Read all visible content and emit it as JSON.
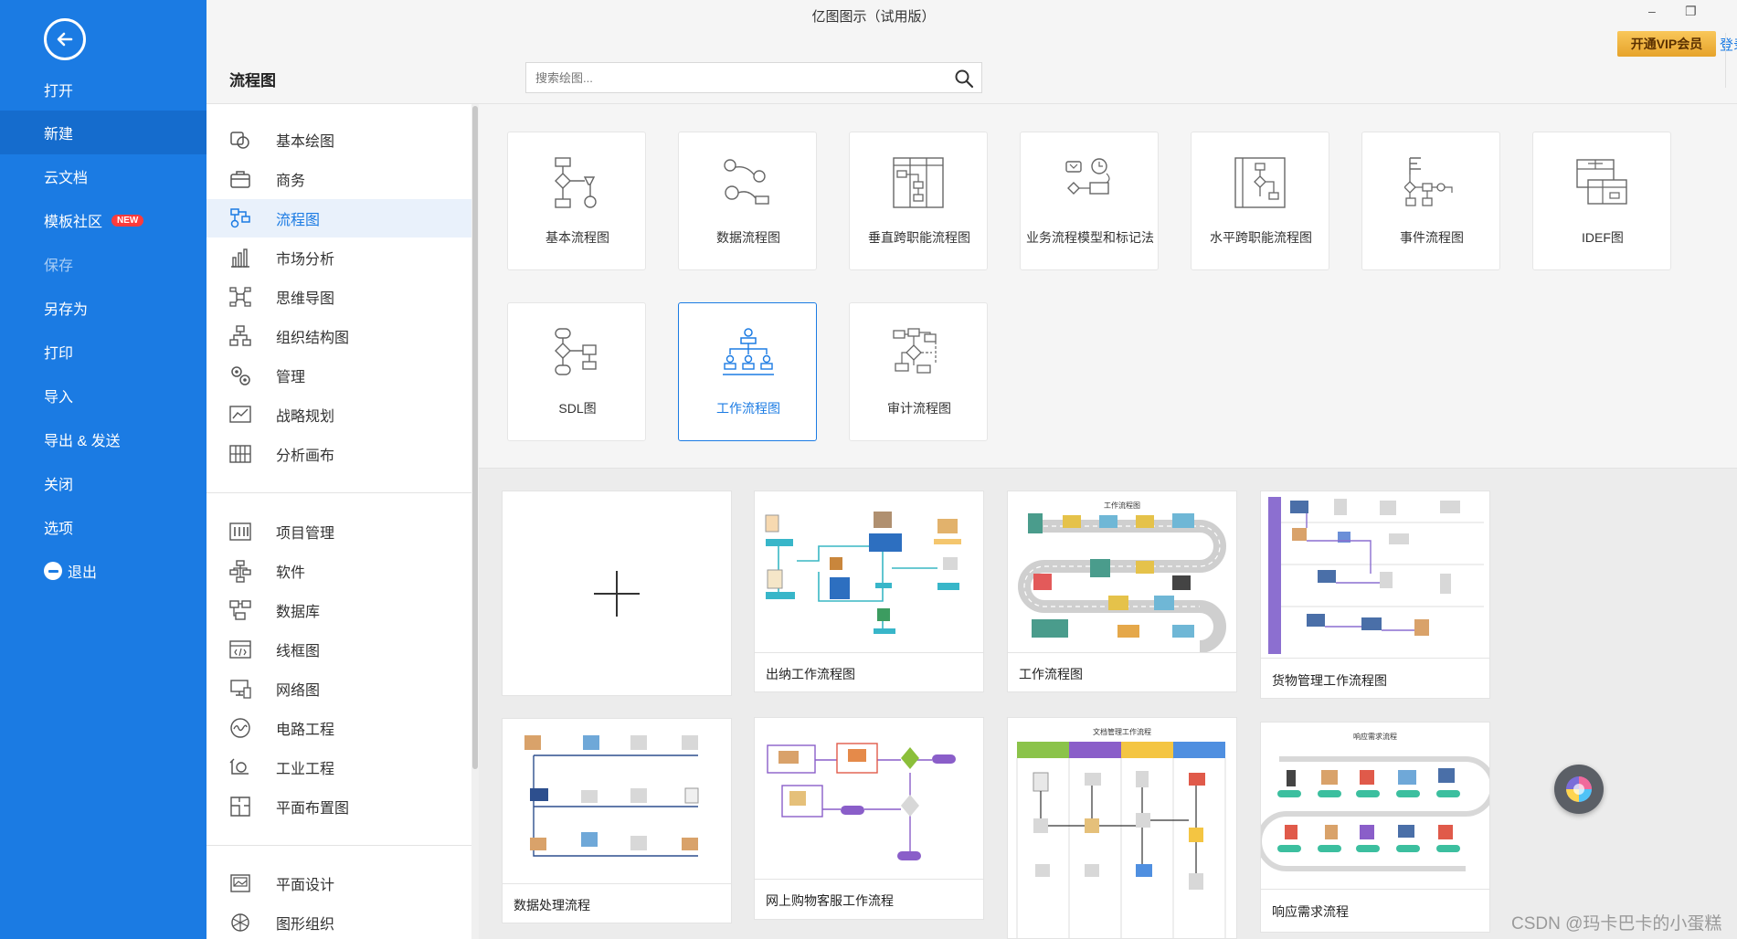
{
  "app": {
    "title": "亿图图示（试用版）",
    "window_controls": {
      "minimize": "–",
      "restore": "❐"
    },
    "vip_button": "开通VIP会员",
    "login_link": "登录"
  },
  "sidebar": {
    "items": [
      {
        "label": "打开",
        "state": "normal"
      },
      {
        "label": "新建",
        "state": "active"
      },
      {
        "label": "云文档",
        "state": "normal"
      },
      {
        "label": "模板社区",
        "state": "normal",
        "badge": "NEW"
      },
      {
        "label": "保存",
        "state": "disabled"
      },
      {
        "label": "另存为",
        "state": "normal"
      },
      {
        "label": "打印",
        "state": "normal"
      },
      {
        "label": "导入",
        "state": "normal"
      },
      {
        "label": "导出 & 发送",
        "state": "normal"
      },
      {
        "label": "关闭",
        "state": "normal"
      },
      {
        "label": "选项",
        "state": "normal"
      },
      {
        "label": "退出",
        "state": "normal"
      }
    ]
  },
  "category_header": {
    "title": "流程图"
  },
  "search": {
    "placeholder": "搜索绘图...",
    "value": ""
  },
  "categories": [
    {
      "label": "基本绘图",
      "icon": "basic-drawing-icon"
    },
    {
      "label": "商务",
      "icon": "briefcase-icon"
    },
    {
      "label": "流程图",
      "icon": "flowchart-icon",
      "active": true
    },
    {
      "label": "市场分析",
      "icon": "bar-chart-icon"
    },
    {
      "label": "思维导图",
      "icon": "mind-map-icon"
    },
    {
      "label": "组织结构图",
      "icon": "org-chart-icon"
    },
    {
      "label": "管理",
      "icon": "gears-icon"
    },
    {
      "label": "战略规划",
      "icon": "line-chart-icon"
    },
    {
      "label": "分析画布",
      "icon": "canvas-grid-icon"
    },
    {
      "label": "项目管理",
      "icon": "gantt-icon"
    },
    {
      "label": "软件",
      "icon": "software-icon"
    },
    {
      "label": "数据库",
      "icon": "database-icon"
    },
    {
      "label": "线框图",
      "icon": "wireframe-icon"
    },
    {
      "label": "网络图",
      "icon": "network-icon"
    },
    {
      "label": "电路工程",
      "icon": "circuit-icon"
    },
    {
      "label": "工业工程",
      "icon": "industrial-icon"
    },
    {
      "label": "平面布置图",
      "icon": "floor-plan-icon"
    },
    {
      "label": "平面设计",
      "icon": "image-icon"
    },
    {
      "label": "图形组织",
      "icon": "graphic-organizer-icon"
    }
  ],
  "diagram_types": [
    {
      "label": "基本流程图",
      "icon": "basic-flowchart-icon"
    },
    {
      "label": "数据流程图",
      "icon": "data-flow-icon"
    },
    {
      "label": "垂直跨职能流程图",
      "icon": "vertical-swimlane-icon"
    },
    {
      "label": "业务流程模型和标记法",
      "icon": "bpmn-icon"
    },
    {
      "label": "水平跨职能流程图",
      "icon": "horizontal-swimlane-icon"
    },
    {
      "label": "事件流程图",
      "icon": "event-flow-icon"
    },
    {
      "label": "IDEF图",
      "icon": "idef-icon"
    },
    {
      "label": "SDL图",
      "icon": "sdl-icon"
    },
    {
      "label": "工作流程图",
      "icon": "workflow-icon",
      "active": true
    },
    {
      "label": "审计流程图",
      "icon": "audit-flow-icon"
    }
  ],
  "templates": [
    {
      "title": "",
      "kind": "blank",
      "icon": "plus-icon"
    },
    {
      "title": "出纳工作流程图",
      "kind": "template"
    },
    {
      "title": "工作流程图",
      "kind": "template",
      "thumb_heading": "工作流程图"
    },
    {
      "title": "货物管理工作流程图",
      "kind": "template"
    },
    {
      "title": "数据处理流程",
      "kind": "template"
    },
    {
      "title": "网上购物客服工作流程",
      "kind": "template"
    },
    {
      "title": "",
      "kind": "template",
      "thumb_heading": "文档管理工作流程"
    },
    {
      "title": "响应需求流程",
      "kind": "template",
      "thumb_heading": "响应需求流程"
    }
  ],
  "watermark": "CSDN @玛卡巴卡的小蛋糕",
  "colors": {
    "sidebar": "#1b7be3",
    "accent": "#1b7be3",
    "vip": "#f0b43c"
  }
}
